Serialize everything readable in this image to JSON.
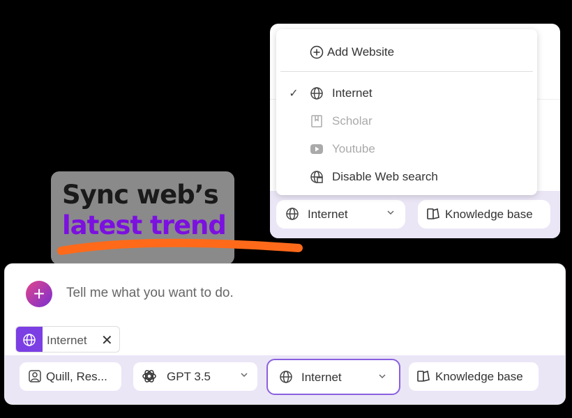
{
  "dropdown": {
    "add_website": "Add Website",
    "items": [
      {
        "label": "Internet",
        "checked": true,
        "disabled": false,
        "icon": "globe-icon"
      },
      {
        "label": "Scholar",
        "checked": false,
        "disabled": true,
        "icon": "book-icon"
      },
      {
        "label": "Youtube",
        "checked": false,
        "disabled": true,
        "icon": "youtube-icon"
      },
      {
        "label": "Disable Web search",
        "checked": false,
        "disabled": false,
        "icon": "globe-off-icon"
      }
    ],
    "check_glyph": "✓"
  },
  "top_toolbar": {
    "source_label": "Internet",
    "knowledge_label": "Knowledge base"
  },
  "promo": {
    "line1": "Sync web’s",
    "line2": "latest trend"
  },
  "composer": {
    "placeholder": "Tell me what you want to do.",
    "chip_label": "Internet",
    "chip_close": "✕",
    "plus": "+"
  },
  "bottom_toolbar": {
    "agent_label": "Quill, Res...",
    "model_label": "GPT 3.5",
    "source_label": "Internet",
    "knowledge_label": "Knowledge base"
  },
  "colors": {
    "accent": "#7b3fe4",
    "toolbar_bg": "#ebe6f6",
    "promo_highlight": "#7b10e0",
    "promo_underline": "#ff6a1a"
  }
}
